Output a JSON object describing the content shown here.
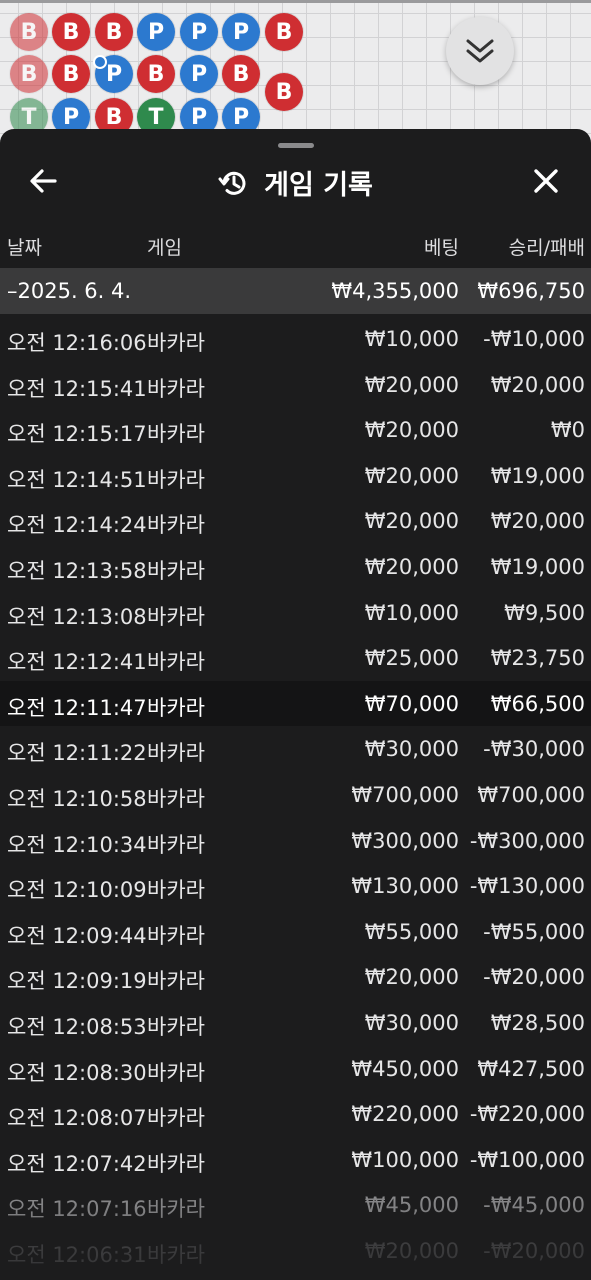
{
  "bead_road": [
    {
      "label": "B",
      "type": "B",
      "faded": true
    },
    {
      "label": "B",
      "type": "B",
      "faded": false
    },
    {
      "label": "B",
      "type": "B",
      "faded": false
    },
    {
      "label": "P",
      "type": "P",
      "faded": false
    },
    {
      "label": "P",
      "type": "P",
      "faded": false
    },
    {
      "label": "P",
      "type": "P",
      "faded": false
    },
    {
      "label": "B",
      "type": "B",
      "faded": false
    },
    {
      "label": "B",
      "type": "B",
      "faded": true
    },
    {
      "label": "B",
      "type": "B",
      "faded": false
    },
    {
      "label": "P",
      "type": "P",
      "faded": false
    },
    {
      "label": "B",
      "type": "B",
      "faded": false
    },
    {
      "label": "P",
      "type": "P",
      "faded": false
    },
    {
      "label": "B",
      "type": "B",
      "faded": false
    },
    {
      "label": "B",
      "type": "B",
      "faded": false
    },
    {
      "label": "T",
      "type": "T",
      "faded": true
    },
    {
      "label": "P",
      "type": "P",
      "faded": false
    },
    {
      "label": "B",
      "type": "B",
      "faded": false
    },
    {
      "label": "T",
      "type": "T",
      "faded": false
    },
    {
      "label": "P",
      "type": "P",
      "faded": false
    },
    {
      "label": "P",
      "type": "P",
      "faded": false
    }
  ],
  "colors": {
    "banker": "#cf2e32",
    "player": "#2c79cf",
    "tie": "#2f8a4d",
    "sheet": "#1c1c1d"
  },
  "header": {
    "title": "게임 기록",
    "back_icon": "arrow-left-icon",
    "history_icon": "history-clock-icon",
    "close_icon": "close-x-icon",
    "collapse_icon": "double-chevron-down-icon"
  },
  "columns": {
    "time": "날짜",
    "game": "게임",
    "bet": "베팅",
    "result": "승리/패배"
  },
  "date_row": {
    "date": "–2025. 6. 4.",
    "bet_total": "₩4,355,000",
    "result_total": "₩696,750"
  },
  "rows": [
    {
      "time": "오전 12:16:06",
      "game": "바카라",
      "bet": "₩10,000",
      "result": "-₩10,000"
    },
    {
      "time": "오전 12:15:41",
      "game": "바카라",
      "bet": "₩20,000",
      "result": "₩20,000"
    },
    {
      "time": "오전 12:15:17",
      "game": "바카라",
      "bet": "₩20,000",
      "result": "₩0"
    },
    {
      "time": "오전 12:14:51",
      "game": "바카라",
      "bet": "₩20,000",
      "result": "₩19,000"
    },
    {
      "time": "오전 12:14:24",
      "game": "바카라",
      "bet": "₩20,000",
      "result": "₩20,000"
    },
    {
      "time": "오전 12:13:58",
      "game": "바카라",
      "bet": "₩20,000",
      "result": "₩19,000"
    },
    {
      "time": "오전 12:13:08",
      "game": "바카라",
      "bet": "₩10,000",
      "result": "₩9,500"
    },
    {
      "time": "오전 12:12:41",
      "game": "바카라",
      "bet": "₩25,000",
      "result": "₩23,750"
    },
    {
      "time": "오전 12:11:47",
      "game": "바카라",
      "bet": "₩70,000",
      "result": "₩66,500"
    },
    {
      "time": "오전 12:11:22",
      "game": "바카라",
      "bet": "₩30,000",
      "result": "-₩30,000"
    },
    {
      "time": "오전 12:10:58",
      "game": "바카라",
      "bet": "₩700,000",
      "result": "₩700,000"
    },
    {
      "time": "오전 12:10:34",
      "game": "바카라",
      "bet": "₩300,000",
      "result": "-₩300,000"
    },
    {
      "time": "오전 12:10:09",
      "game": "바카라",
      "bet": "₩130,000",
      "result": "-₩130,000"
    },
    {
      "time": "오전 12:09:44",
      "game": "바카라",
      "bet": "₩55,000",
      "result": "-₩55,000"
    },
    {
      "time": "오전 12:09:19",
      "game": "바카라",
      "bet": "₩20,000",
      "result": "-₩20,000"
    },
    {
      "time": "오전 12:08:53",
      "game": "바카라",
      "bet": "₩30,000",
      "result": "₩28,500"
    },
    {
      "time": "오전 12:08:30",
      "game": "바카라",
      "bet": "₩450,000",
      "result": "₩427,500"
    },
    {
      "time": "오전 12:08:07",
      "game": "바카라",
      "bet": "₩220,000",
      "result": "-₩220,000"
    },
    {
      "time": "오전 12:07:42",
      "game": "바카라",
      "bet": "₩100,000",
      "result": "-₩100,000"
    },
    {
      "time": "오전 12:07:16",
      "game": "바카라",
      "bet": "₩45,000",
      "result": "-₩45,000"
    },
    {
      "time": "오전 12:06:31",
      "game": "바카라",
      "bet": "₩20,000",
      "result": "-₩20,000"
    }
  ]
}
